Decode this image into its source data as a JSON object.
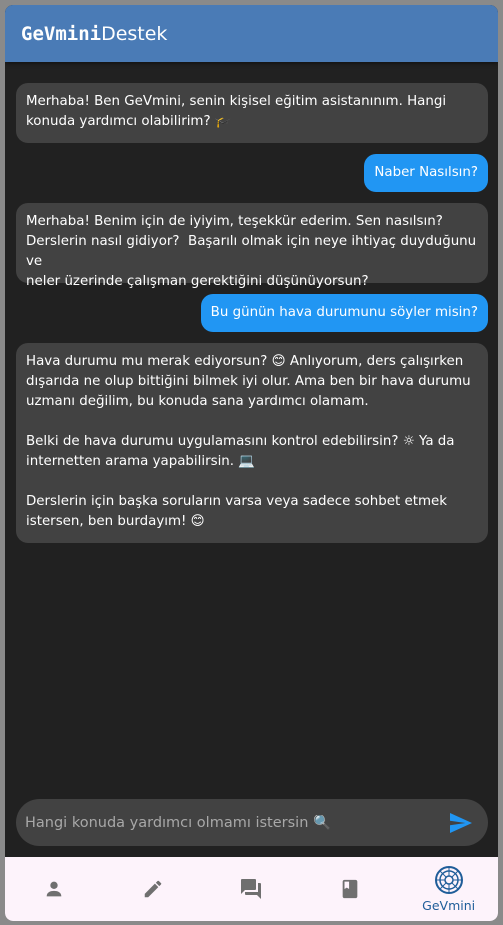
{
  "app": {
    "title_mono": "GeVmini",
    "title_sans": "Destek"
  },
  "messages": [
    {
      "role": "bot",
      "text": "Merhaba! Ben GeVmini, senin kişisel eğitim asistanınım. Hangi\nkonuda yardımcı olabilirim? 🎓"
    },
    {
      "role": "user",
      "text": "Naber Nasılsın?"
    },
    {
      "role": "bot",
      "text": "Merhaba! Benim için de iyiyim, teşekkür ederim. Sen nasılsın?\nDerslerin nasıl gidiyor?  Başarılı olmak için neye ihtiyaç duyduğunu ve\nneler üzerinde çalışman gerektiğini düşünüyorsun?"
    },
    {
      "role": "user",
      "text": "Bu günün hava durumunu söyler misin?"
    },
    {
      "role": "bot",
      "text": "Hava durumu mu merak ediyorsun? 😊 Anlıyorum, ders çalışırken\ndışarıda ne olup bittiğini bilmek iyi olur. Ama ben bir hava durumu\nuzmanı değilim, bu konuda sana yardımcı olamam.\n\nBelki de hava durumu uygulamasını kontrol edebilirsin? ☼ Ya da\ninternetten arama yapabilirsin. 💻\n\nDerslerin için başka soruların varsa veya sadece sohbet etmek\nistersen, ben burdayım! 😊"
    }
  ],
  "input": {
    "placeholder": "Hangi konuda yardımcı olmamı istersin 🔍",
    "value": ""
  },
  "nav": {
    "items": [
      {
        "icon": "person-icon",
        "label": ""
      },
      {
        "icon": "pencil-icon",
        "label": ""
      },
      {
        "icon": "forum-icon",
        "label": ""
      },
      {
        "icon": "book-icon",
        "label": ""
      },
      {
        "icon": "gevmini-logo-icon",
        "label": "GeVmini"
      }
    ],
    "selected": "GeVmini"
  },
  "colors": {
    "appbar": "#4a7bb6",
    "background": "#212121",
    "bot_bubble": "#424242",
    "user_bubble": "#2196f3",
    "nav_bg": "#fdf3fb",
    "nav_icon": "#6f6f6f",
    "nav_selected": "#1f5d99",
    "send": "#2196f3"
  }
}
